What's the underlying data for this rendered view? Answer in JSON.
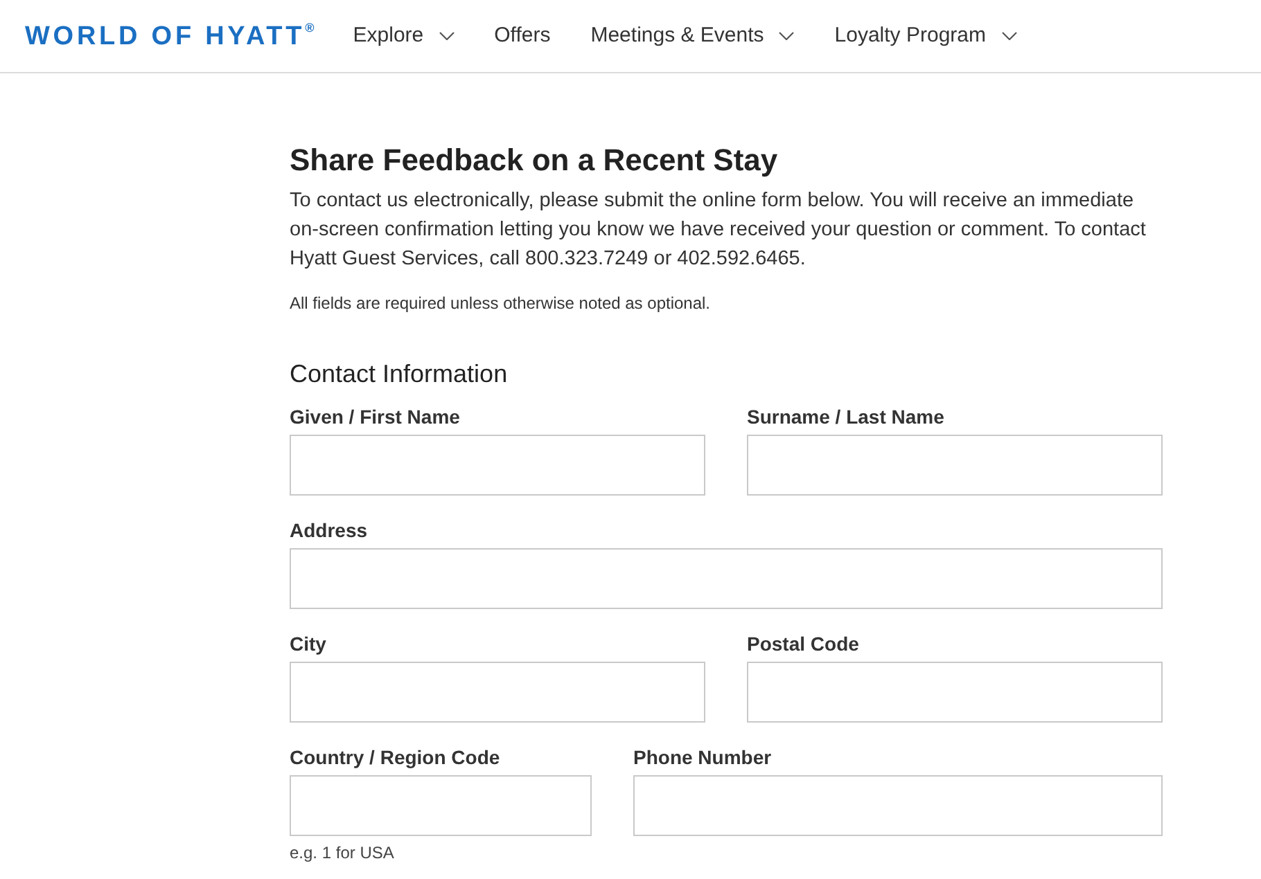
{
  "header": {
    "logo": "WORLD OF HYATT$^{®}$",
    "nav": [
      {
        "label": "Explore",
        "has_menu": true
      },
      {
        "label": "Offers",
        "has_menu": false
      },
      {
        "label": "Meetings & Events",
        "has_menu": true
      },
      {
        "label": "Loyalty Program",
        "has_menu": true
      }
    ]
  },
  "form": {
    "title": "Share Feedback on a Recent Stay",
    "intro": "To contact us electronically, please submit the online form below. You will receive an immediate on-screen confirmation letting you know we have received your question or comment. To contact Hyatt Guest Services, call 800.323.7249 or 402.592.6465.",
    "note": "All fields are required unless otherwise noted as optional.",
    "section": "Contact Information",
    "rows": [
      {
        "kind": "pair",
        "fields": [
          {
            "label": "Given / First Name"
          },
          {
            "label": "Surname / Last Name"
          }
        ]
      },
      {
        "kind": "single",
        "fields": [
          {
            "label": "Address"
          }
        ]
      },
      {
        "kind": "pair",
        "fields": [
          {
            "label": "City"
          },
          {
            "label": "Postal Code"
          }
        ]
      },
      {
        "kind": "code_pair",
        "fields": [
          {
            "label": "Country / Region Code",
            "hint": "e.g. 1 for USA"
          },
          {
            "label": "Phone Number"
          }
        ]
      }
    ]
  }
}
